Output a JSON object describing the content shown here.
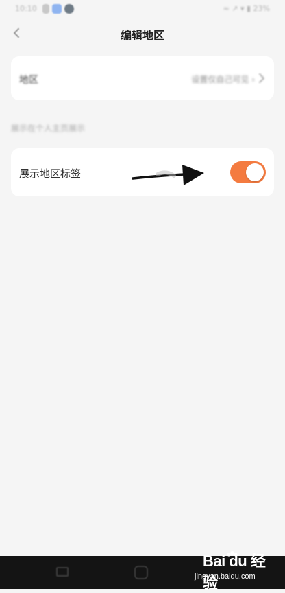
{
  "status_bar": {
    "time": "10:10",
    "right_text": "≈ ↗ ▾ ▮ 23%"
  },
  "header": {
    "title": "编辑地区"
  },
  "region_row": {
    "label": "地区",
    "value": "设置仅自己可见 ›"
  },
  "section_hint": "展示在个人主页展示",
  "toggle_row": {
    "label": "展示地区标签",
    "enabled": true
  },
  "watermark": {
    "brand": "Bai du 经验",
    "url": "jingyan.baidu.com"
  },
  "colors": {
    "toggle_on": "#f47b40",
    "background": "#f5f5f5",
    "card": "#ffffff"
  },
  "icons": {
    "back": "chevron-left-icon",
    "region_chevron": "chevron-right-icon",
    "menu": "menu-square-icon",
    "home": "home-square-icon"
  }
}
